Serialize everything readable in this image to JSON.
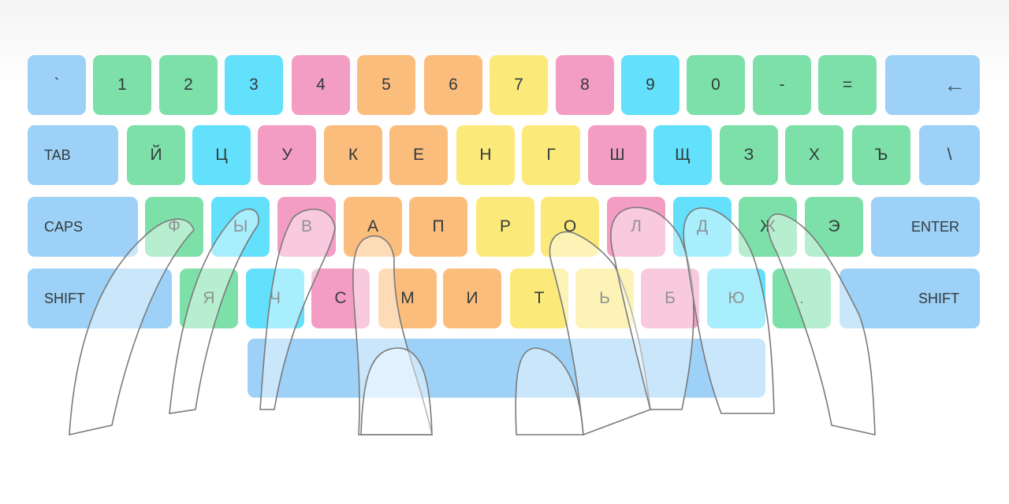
{
  "colors": {
    "blue": "#9dd1f7",
    "green": "#7ce0a8",
    "cyan": "#62e0fc",
    "pink": "#f49dc4",
    "orange": "#fbbd7c",
    "yellow": "#fbe97a",
    "hand_outline": "#7a7a7a"
  },
  "rows": [
    [
      {
        "label": "`",
        "color": "blue"
      },
      {
        "label": "1",
        "color": "green"
      },
      {
        "label": "2",
        "color": "green"
      },
      {
        "label": "3",
        "color": "cyan"
      },
      {
        "label": "4",
        "color": "pink"
      },
      {
        "label": "5",
        "color": "orange"
      },
      {
        "label": "6",
        "color": "orange"
      },
      {
        "label": "7",
        "color": "yellow"
      },
      {
        "label": "8",
        "color": "pink"
      },
      {
        "label": "9",
        "color": "cyan"
      },
      {
        "label": "0",
        "color": "green"
      },
      {
        "label": "-",
        "color": "green"
      },
      {
        "label": "=",
        "color": "green"
      },
      {
        "label": "←",
        "color": "blue"
      }
    ],
    [
      {
        "label": "TAB",
        "color": "blue"
      },
      {
        "label": "Й",
        "color": "green"
      },
      {
        "label": "Ц",
        "color": "cyan"
      },
      {
        "label": "У",
        "color": "pink"
      },
      {
        "label": "К",
        "color": "orange"
      },
      {
        "label": "Е",
        "color": "orange"
      },
      {
        "label": "Н",
        "color": "yellow"
      },
      {
        "label": "Г",
        "color": "yellow"
      },
      {
        "label": "Ш",
        "color": "pink"
      },
      {
        "label": "Щ",
        "color": "cyan"
      },
      {
        "label": "З",
        "color": "green"
      },
      {
        "label": "Х",
        "color": "green"
      },
      {
        "label": "Ъ",
        "color": "green"
      },
      {
        "label": "\\",
        "color": "blue"
      }
    ],
    [
      {
        "label": "CAPS",
        "color": "blue"
      },
      {
        "label": "Ф",
        "color": "green"
      },
      {
        "label": "Ы",
        "color": "cyan"
      },
      {
        "label": "В",
        "color": "pink"
      },
      {
        "label": "А",
        "color": "orange"
      },
      {
        "label": "П",
        "color": "orange"
      },
      {
        "label": "Р",
        "color": "yellow"
      },
      {
        "label": "О",
        "color": "yellow"
      },
      {
        "label": "Л",
        "color": "pink"
      },
      {
        "label": "Д",
        "color": "cyan"
      },
      {
        "label": "Ж",
        "color": "green"
      },
      {
        "label": "Э",
        "color": "green"
      },
      {
        "label": "ENTER",
        "color": "blue"
      }
    ],
    [
      {
        "label": "SHIFT",
        "color": "blue"
      },
      {
        "label": "Я",
        "color": "green"
      },
      {
        "label": "Ч",
        "color": "cyan"
      },
      {
        "label": "С",
        "color": "pink"
      },
      {
        "label": "М",
        "color": "orange"
      },
      {
        "label": "И",
        "color": "orange"
      },
      {
        "label": "Т",
        "color": "yellow"
      },
      {
        "label": "Ь",
        "color": "yellow"
      },
      {
        "label": "Б",
        "color": "pink"
      },
      {
        "label": "Ю",
        "color": "cyan"
      },
      {
        "label": ".",
        "color": "green"
      },
      {
        "label": "SHIFT",
        "color": "blue"
      }
    ],
    [
      {
        "label": "",
        "color": "blue"
      }
    ]
  ]
}
